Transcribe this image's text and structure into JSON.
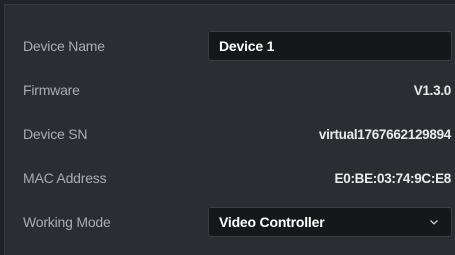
{
  "device": {
    "name_label": "Device Name",
    "name_value": "Device 1",
    "firmware_label": "Firmware",
    "firmware_value": "V1.3.0",
    "sn_label": "Device SN",
    "sn_value": "virtual1767662129894",
    "mac_label": "MAC Address",
    "mac_value": "E0:BE:03:74:9C:E8",
    "mode_label": "Working Mode",
    "mode_value": "Video Controller"
  },
  "icons": {
    "chevron": "chevron-down-icon"
  },
  "colors": {
    "background": "#2a2d31",
    "label": "#a9adb3",
    "value": "#e8eaed",
    "input_bg": "#15171a"
  }
}
